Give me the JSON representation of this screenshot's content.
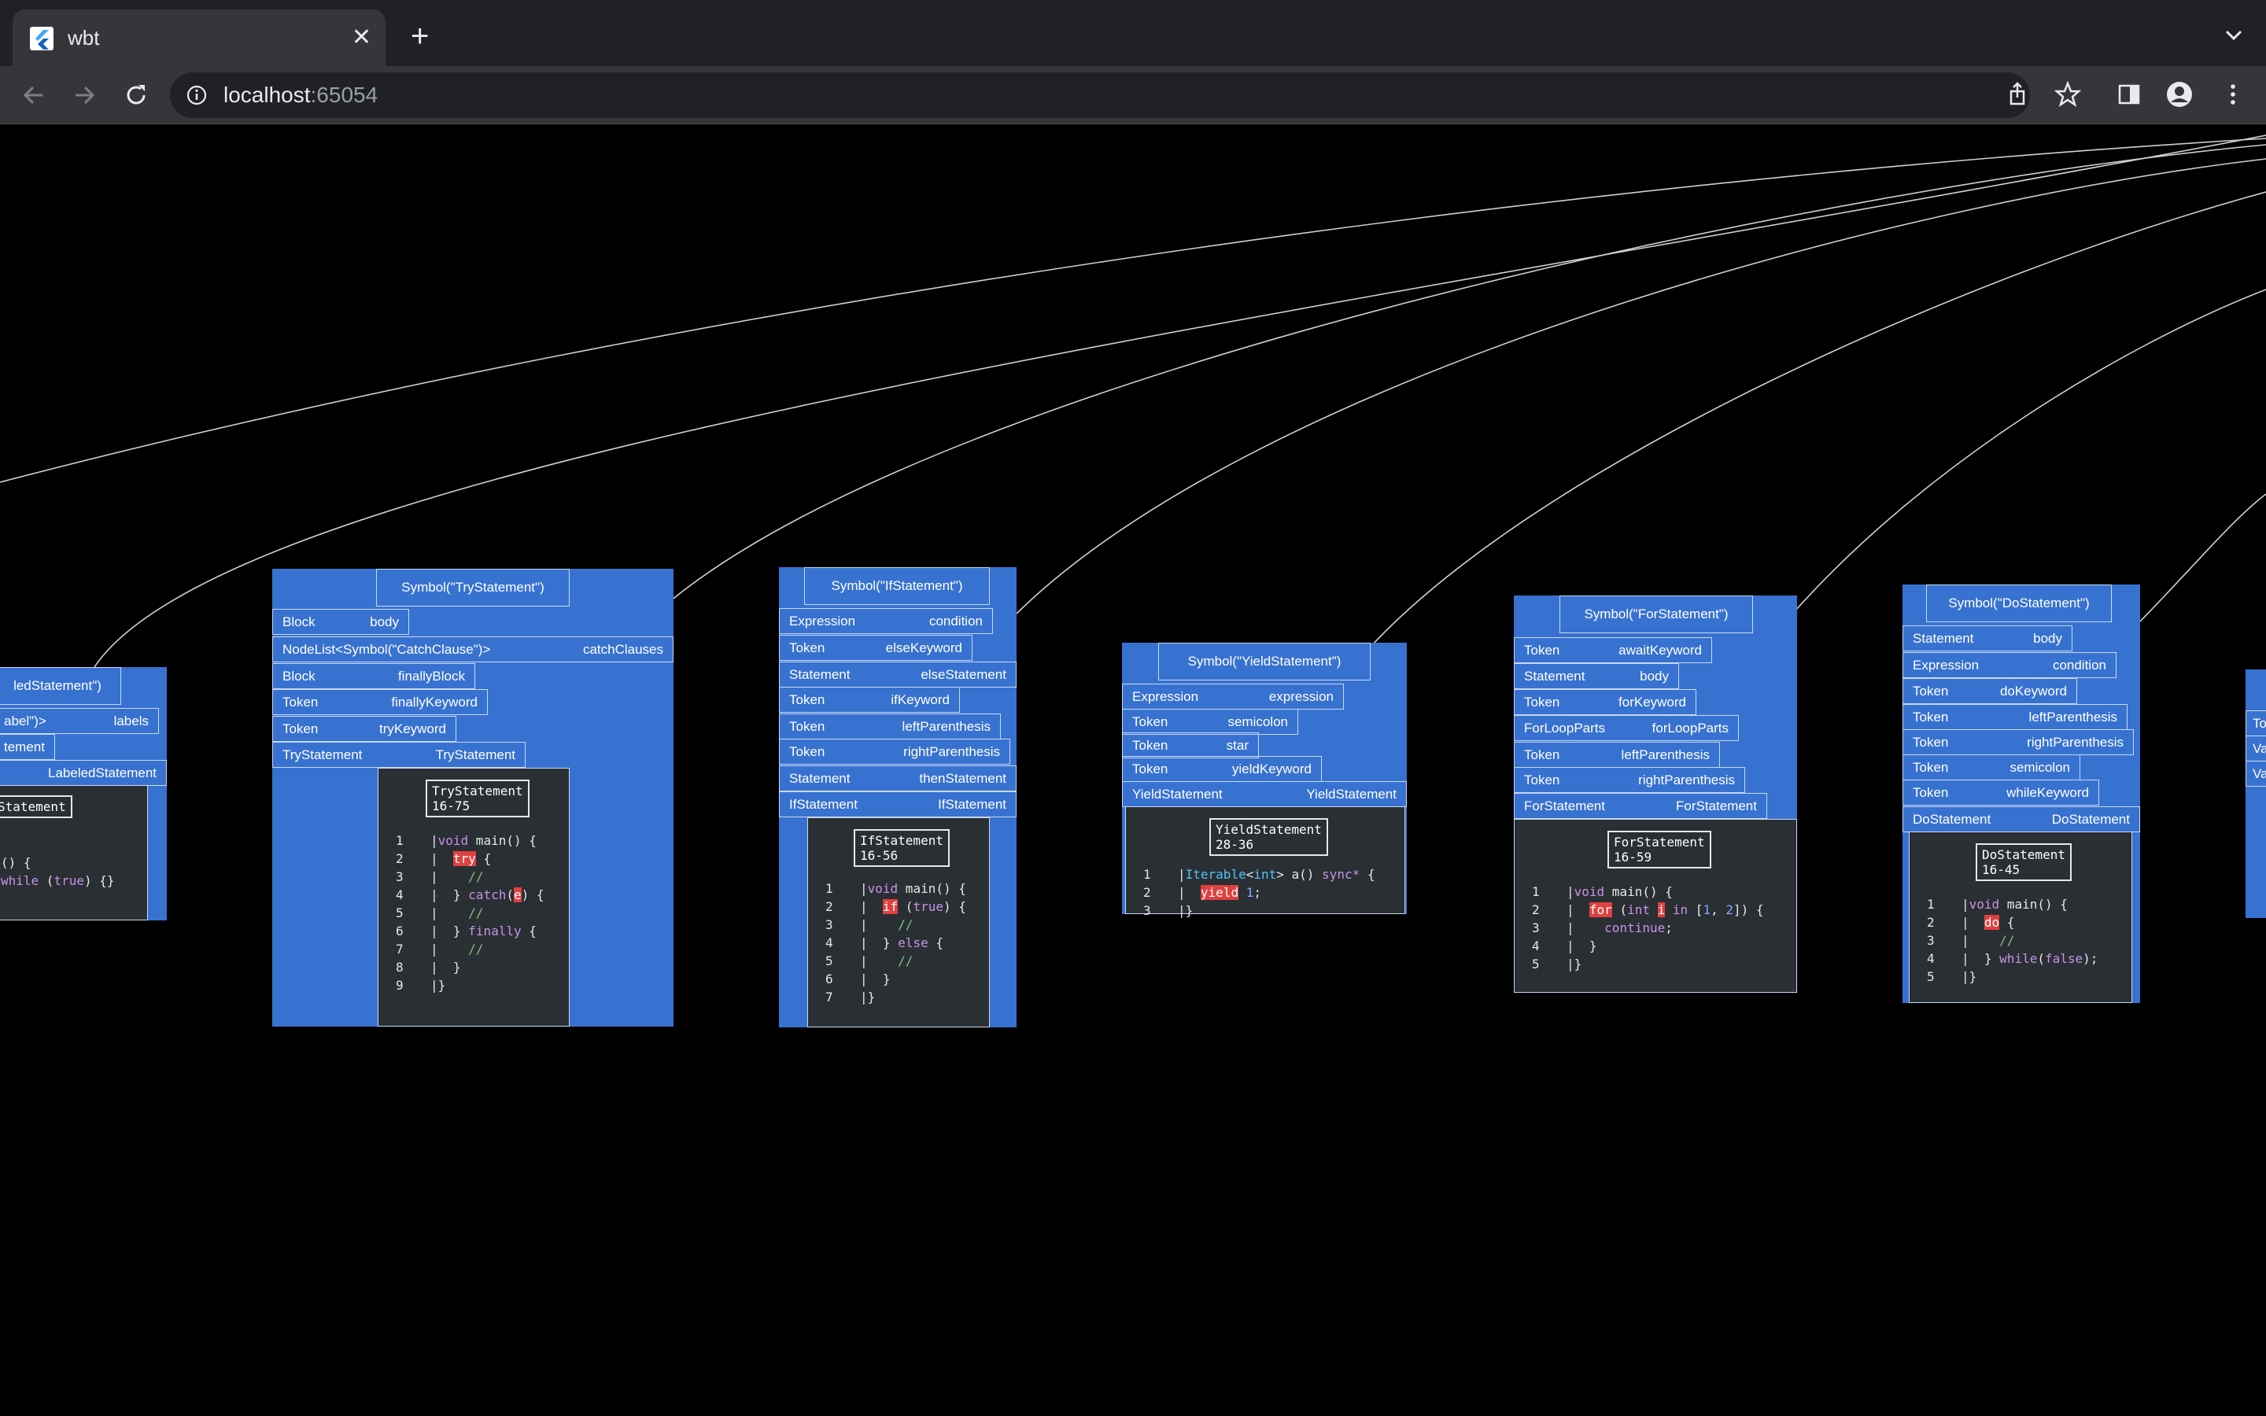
{
  "browser": {
    "tab_title": "wbt",
    "url_host": "localhost",
    "url_port": ":65054"
  },
  "nodes": {
    "labeled": {
      "symbol": "ledStatement\")",
      "fields": [
        {
          "type": "abel\")>",
          "name": "labels"
        },
        {
          "type": "tement",
          "name": ""
        },
        {
          "type": "",
          "name": "LabeledStatement"
        }
      ],
      "code_header": "Statement",
      "code_lines": [
        {
          "num": "",
          "text": "() {"
        },
        {
          "num": "",
          "text": "while (true) {}"
        }
      ]
    },
    "try": {
      "symbol": "Symbol(\"TryStatement\")",
      "fields": [
        {
          "type": "Block",
          "name": "body"
        },
        {
          "type": "NodeList<Symbol(\"CatchClause\")>",
          "name": "catchClauses"
        },
        {
          "type": "Block",
          "name": "finallyBlock"
        },
        {
          "type": "Token",
          "name": "finallyKeyword"
        },
        {
          "type": "Token",
          "name": "tryKeyword"
        },
        {
          "type": "TryStatement",
          "name": "TryStatement"
        }
      ],
      "code_header": "TryStatement\n16-75",
      "code_lines": [
        {
          "num": "1",
          "text": "|void main() {"
        },
        {
          "num": "2",
          "text": "|  try {"
        },
        {
          "num": "3",
          "text": "|    //"
        },
        {
          "num": "4",
          "text": "|  } catch(e) {"
        },
        {
          "num": "5",
          "text": "|    //"
        },
        {
          "num": "6",
          "text": "|  } finally {"
        },
        {
          "num": "7",
          "text": "|    //"
        },
        {
          "num": "8",
          "text": "|  }"
        },
        {
          "num": "9",
          "text": "|}"
        }
      ]
    },
    "if": {
      "symbol": "Symbol(\"IfStatement\")",
      "fields": [
        {
          "type": "Expression",
          "name": "condition"
        },
        {
          "type": "Token",
          "name": "elseKeyword"
        },
        {
          "type": "Statement",
          "name": "elseStatement"
        },
        {
          "type": "Token",
          "name": "ifKeyword"
        },
        {
          "type": "Token",
          "name": "leftParenthesis"
        },
        {
          "type": "Token",
          "name": "rightParenthesis"
        },
        {
          "type": "Statement",
          "name": "thenStatement"
        },
        {
          "type": "IfStatement",
          "name": "IfStatement"
        }
      ],
      "code_header": "IfStatement\n16-56",
      "code_lines": [
        {
          "num": "1",
          "text": "|void main() {"
        },
        {
          "num": "2",
          "text": "|  if (true) {"
        },
        {
          "num": "3",
          "text": "|    //"
        },
        {
          "num": "4",
          "text": "|  } else {"
        },
        {
          "num": "5",
          "text": "|    //"
        },
        {
          "num": "6",
          "text": "|  }"
        },
        {
          "num": "7",
          "text": "|}"
        }
      ]
    },
    "yield": {
      "symbol": "Symbol(\"YieldStatement\")",
      "fields": [
        {
          "type": "Expression",
          "name": "expression"
        },
        {
          "type": "Token",
          "name": "semicolon"
        },
        {
          "type": "Token",
          "name": "star"
        },
        {
          "type": "Token",
          "name": "yieldKeyword"
        },
        {
          "type": "YieldStatement",
          "name": "YieldStatement"
        }
      ],
      "code_header": "YieldStatement\n28-36",
      "code_lines": [
        {
          "num": "1",
          "text": "|Iterable<int> a() sync* {"
        },
        {
          "num": "2",
          "text": "|  yield 1;"
        },
        {
          "num": "3",
          "text": "|}"
        }
      ]
    },
    "for": {
      "symbol": "Symbol(\"ForStatement\")",
      "fields": [
        {
          "type": "Token",
          "name": "awaitKeyword"
        },
        {
          "type": "Statement",
          "name": "body"
        },
        {
          "type": "Token",
          "name": "forKeyword"
        },
        {
          "type": "ForLoopParts",
          "name": "forLoopParts"
        },
        {
          "type": "Token",
          "name": "leftParenthesis"
        },
        {
          "type": "Token",
          "name": "rightParenthesis"
        },
        {
          "type": "ForStatement",
          "name": "ForStatement"
        }
      ],
      "code_header": "ForStatement\n16-59",
      "code_lines": [
        {
          "num": "1",
          "text": "|void main() {"
        },
        {
          "num": "2",
          "text": "|  for (int i in [1, 2]) {"
        },
        {
          "num": "3",
          "text": "|    continue;"
        },
        {
          "num": "4",
          "text": "|  }"
        },
        {
          "num": "5",
          "text": "|}"
        }
      ]
    },
    "do": {
      "symbol": "Symbol(\"DoStatement\")",
      "fields": [
        {
          "type": "Statement",
          "name": "body"
        },
        {
          "type": "Expression",
          "name": "condition"
        },
        {
          "type": "Token",
          "name": "doKeyword"
        },
        {
          "type": "Token",
          "name": "leftParenthesis"
        },
        {
          "type": "Token",
          "name": "rightParenthesis"
        },
        {
          "type": "Token",
          "name": "semicolon"
        },
        {
          "type": "Token",
          "name": "whileKeyword"
        },
        {
          "type": "DoStatement",
          "name": "DoStatement"
        }
      ],
      "code_header": "DoStatement\n16-45",
      "code_lines": [
        {
          "num": "1",
          "text": "|void main() {"
        },
        {
          "num": "2",
          "text": "|  do {"
        },
        {
          "num": "3",
          "text": "|    //"
        },
        {
          "num": "4",
          "text": "|  } while(false);"
        },
        {
          "num": "5",
          "text": "|}"
        }
      ]
    },
    "partial_right": {
      "fields": [
        {
          "type": "To"
        },
        {
          "type": "Va"
        },
        {
          "type": "Va"
        }
      ]
    }
  },
  "colors": {
    "node_fill": "#3872d0",
    "code_bg": "#2a2f33",
    "keyword_highlight": "#e04040",
    "edge": "#d0d0d0"
  }
}
